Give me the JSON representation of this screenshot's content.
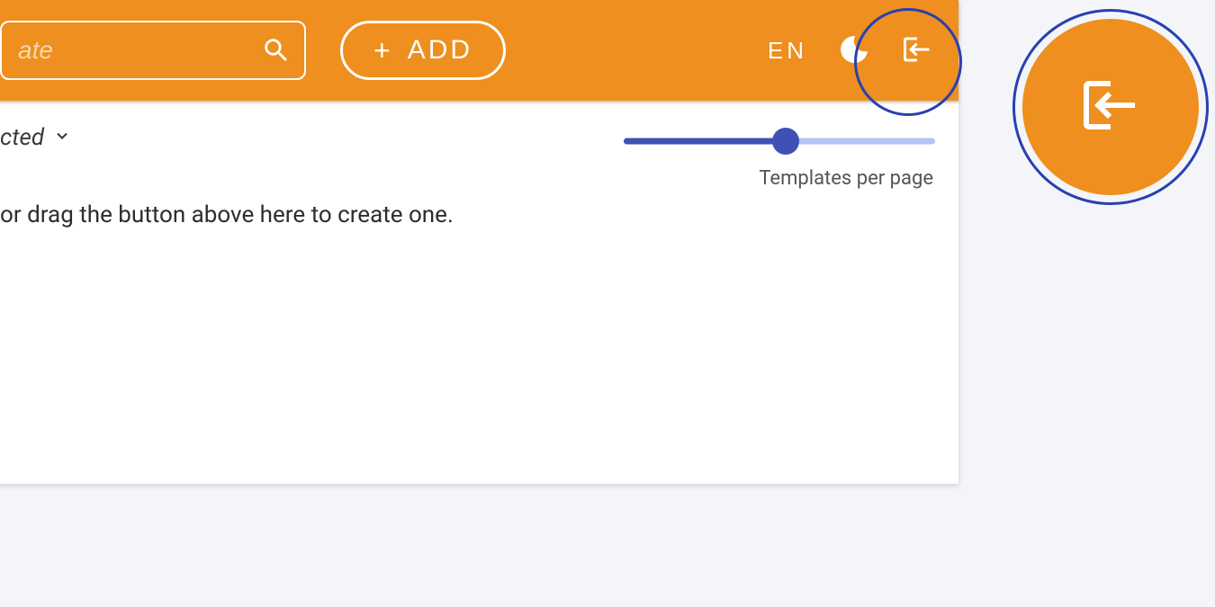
{
  "toolbar": {
    "search_placeholder": "ate",
    "add_label": "ADD",
    "language": "EN"
  },
  "body": {
    "selected_label": "cted",
    "hint_text": " or drag the button above here to create one.",
    "slider": {
      "label": "Templates per page",
      "percent": 52
    }
  }
}
